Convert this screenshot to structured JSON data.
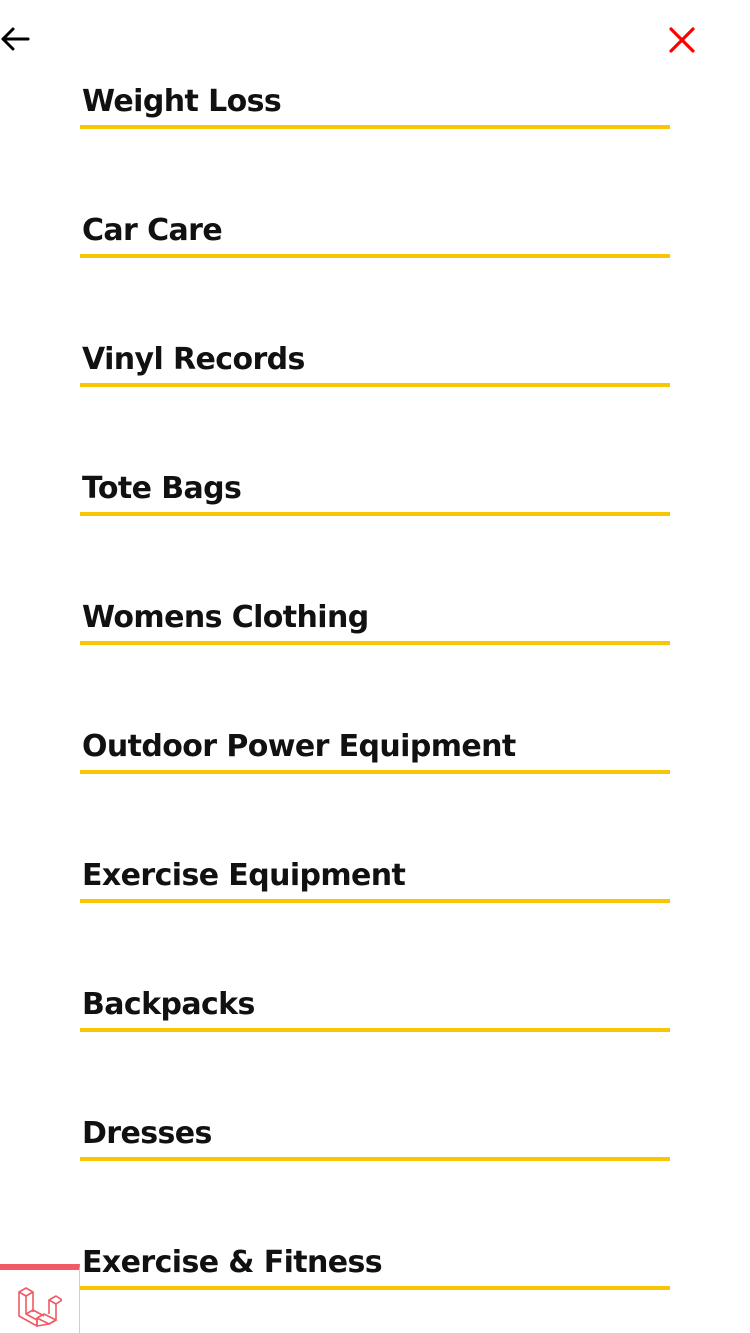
{
  "header": {
    "back_icon": "arrow-left-icon",
    "close_icon": "close-x-icon",
    "close_color": "#ff0000"
  },
  "menu": {
    "underline_color": "#f7c600",
    "items": [
      {
        "label": "Weight Loss"
      },
      {
        "label": "Car Care"
      },
      {
        "label": "Vinyl Records"
      },
      {
        "label": "Tote Bags"
      },
      {
        "label": "Womens Clothing"
      },
      {
        "label": "Outdoor Power Equipment"
      },
      {
        "label": "Exercise Equipment"
      },
      {
        "label": "Backpacks"
      },
      {
        "label": "Dresses"
      },
      {
        "label": "Exercise & Fitness"
      }
    ]
  },
  "dev_toolbar": {
    "icon": "laravel-logo-icon",
    "accent_color": "#f05a64"
  }
}
